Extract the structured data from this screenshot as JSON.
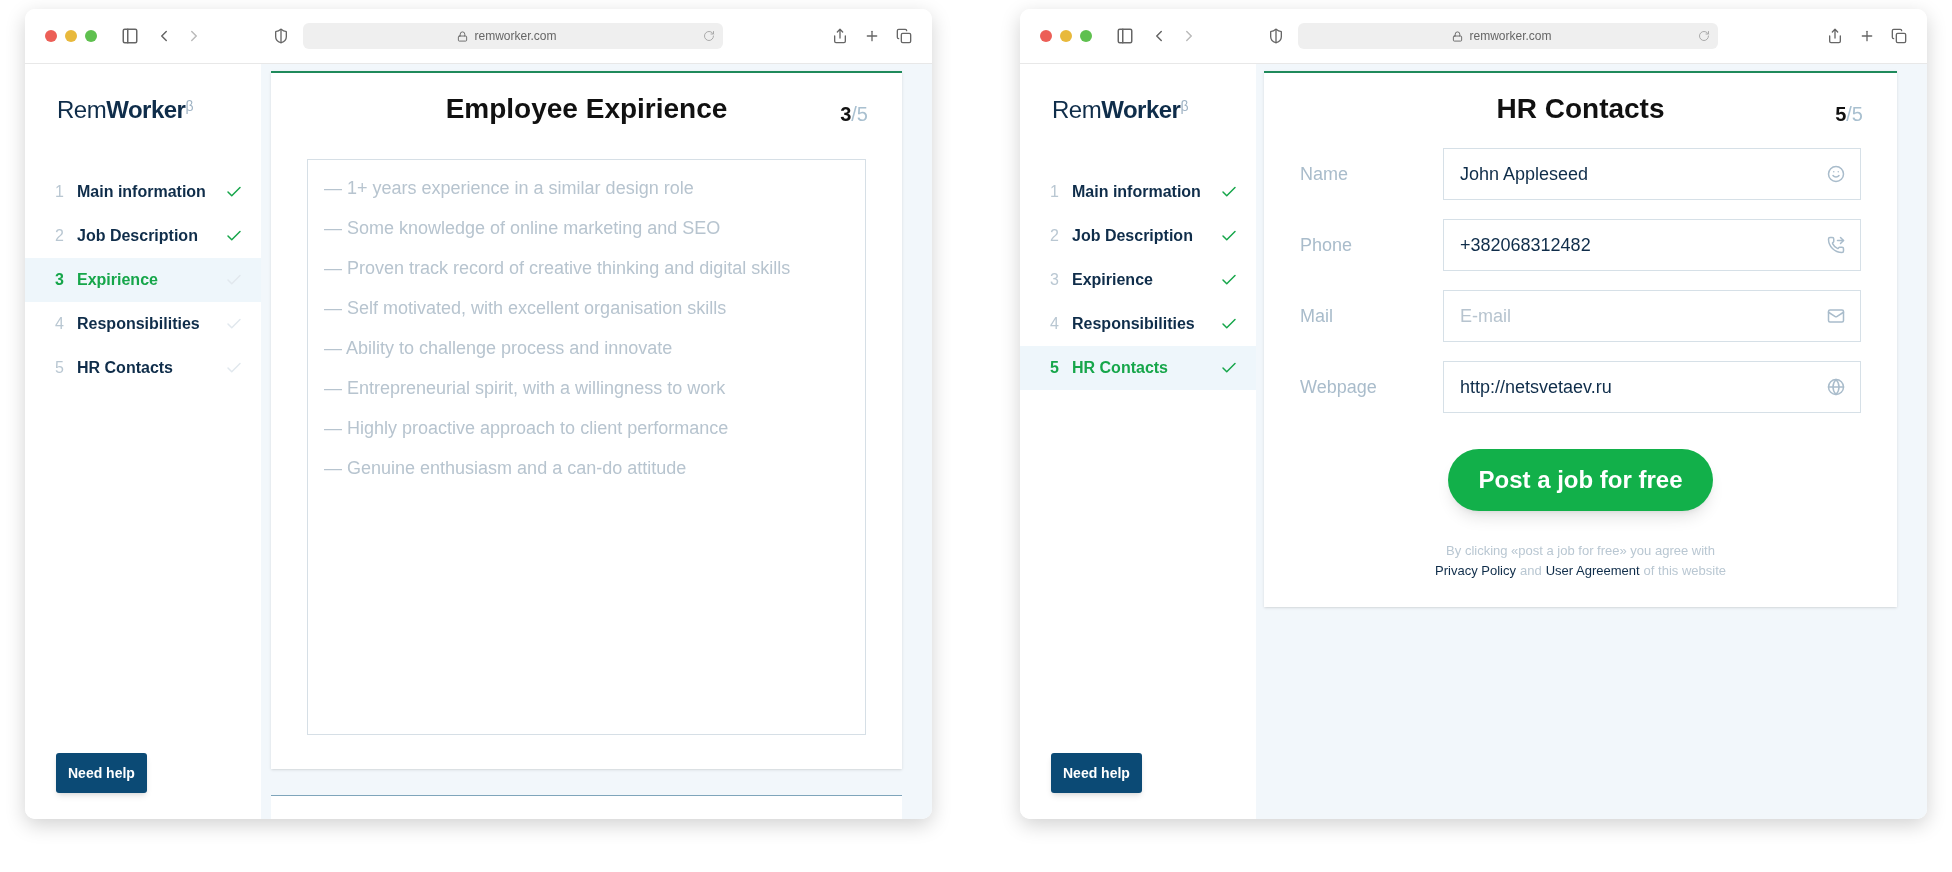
{
  "windows": [
    {
      "url": "remworker.com",
      "logo": {
        "text": "Rem**Worker**",
        "mark": "β"
      },
      "steps": [
        {
          "number": "1",
          "label": "Main information",
          "done": true,
          "selected": false
        },
        {
          "number": "2",
          "label": "Job Description",
          "done": true,
          "selected": false
        },
        {
          "number": "3",
          "label": "Expirience",
          "done": false,
          "selected": true
        },
        {
          "number": "4",
          "label": "Responsibilities",
          "done": false,
          "selected": false
        },
        {
          "number": "5",
          "label": "HR Contacts",
          "done": false,
          "selected": false
        }
      ],
      "help_button": "Need help",
      "panel": {
        "kind": "textarea",
        "title": "Employee Expirience",
        "step": "3",
        "total": "/5",
        "lines": [
          "— 1+ years experience in a similar design role",
          "— Some knowledge of online marketing and SEO",
          "— Proven track record of creative thinking and digital skills",
          "— Self motivated, with excellent organisation skills",
          "— Ability to challenge process and innovate",
          "— Entrepreneurial spirit, with a willingness to work",
          "— Highly proactive approach to client performance",
          "— Genuine enthusiasm and a can-do attitude"
        ]
      }
    },
    {
      "url": "remworker.com",
      "logo": {
        "text": "Rem**Worker**",
        "mark": "β"
      },
      "steps": [
        {
          "number": "1",
          "label": "Main information",
          "done": true,
          "selected": false
        },
        {
          "number": "2",
          "label": "Job Description",
          "done": true,
          "selected": false
        },
        {
          "number": "3",
          "label": "Expirience",
          "done": true,
          "selected": false
        },
        {
          "number": "4",
          "label": "Responsibilities",
          "done": true,
          "selected": false
        },
        {
          "number": "5",
          "label": "HR Contacts",
          "done": true,
          "selected": true
        }
      ],
      "help_button": "Need help",
      "panel": {
        "kind": "form",
        "title": "HR Contacts",
        "step": "5",
        "total": "/5",
        "fields": [
          {
            "label": "Name",
            "value": "John Appleseed"
          },
          {
            "label": "Phone",
            "value": "+382068312482"
          },
          {
            "label": "Mail",
            "placeholder": "E-mail"
          },
          {
            "label": "Webpage",
            "value": "http://netsvetaev.ru"
          }
        ],
        "submit": "Post a job for free",
        "legal": {
          "intro": "By clicking «post a job for free» you agree with",
          "link_1": "Privacy Policy",
          "joiner": "and",
          "link_2": "User Agreement",
          "tail": "of this website"
        }
      }
    }
  ]
}
